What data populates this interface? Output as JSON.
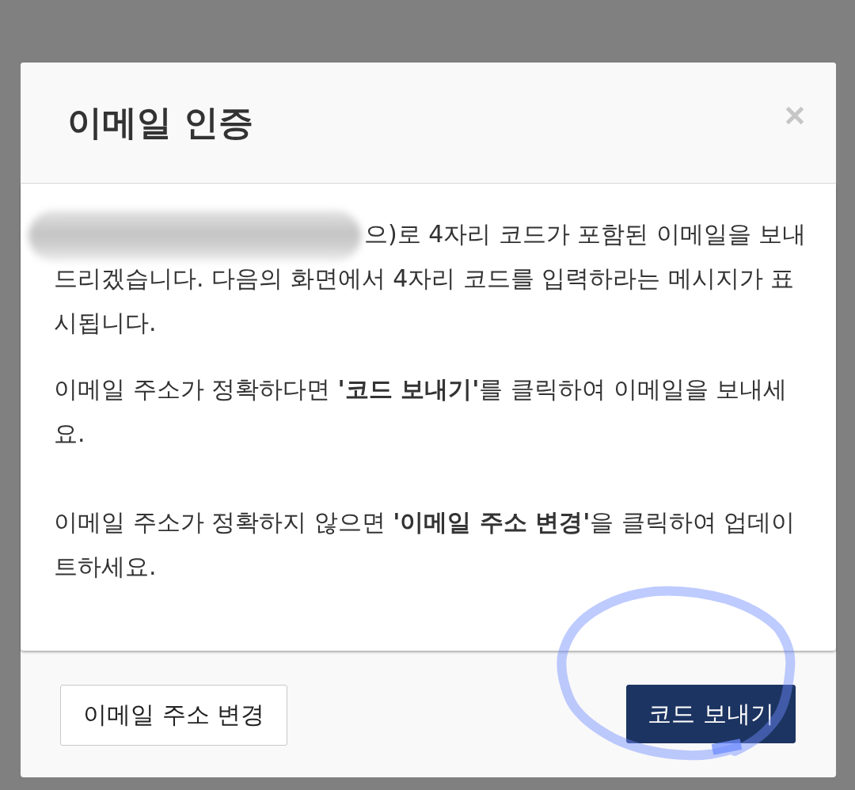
{
  "dialog": {
    "title": "이메일 인증"
  },
  "body": {
    "paragraphs": [
      {
        "text": "으)로 4자리 코드가 포함된 이메일을 보내드리겠습니다. 다음의 화면에서 4자리 코드를 입력하라는 메시지가 표시됩니다.",
        "redacted": true
      },
      {
        "text": "이메일 주소가 정확하다면 **'코드 보내기'**를 클릭하여 이메일을 보내세요.",
        "redacted": false
      },
      {
        "text": "이메일 주소가 정확하지 않으면 **'이메일 주소 변경'**을 클릭하여 업데이트하세요.",
        "redacted": false
      }
    ]
  },
  "footer": {
    "buttons": [
      {
        "label": "이메일 주소 변경",
        "kind": "secondary",
        "circled": false
      },
      {
        "label": "코드 보내기",
        "kind": "primary",
        "circled": true
      }
    ]
  }
}
